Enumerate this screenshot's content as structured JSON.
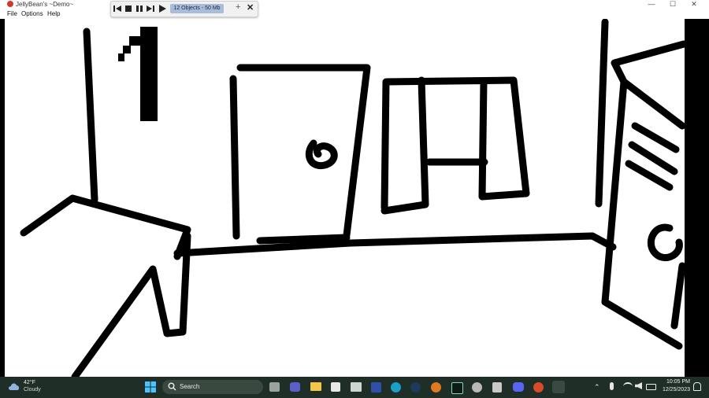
{
  "window": {
    "title": "JellyBean's ~Demo~",
    "minimize_glyph": "—",
    "maximize_glyph": "☐",
    "close_glyph": "✕"
  },
  "menu": {
    "items": [
      {
        "label": "File"
      },
      {
        "label": "Options"
      },
      {
        "label": "Help"
      }
    ]
  },
  "toolbar": {
    "status": "12 Objects - 50 Mb",
    "add_glyph": "+",
    "close_glyph": "✕",
    "buttons": [
      "skip-back",
      "stop",
      "pause",
      "skip-forward",
      "play"
    ]
  },
  "taskbar": {
    "weather_temp": "42°F",
    "weather_condition": "Cloudy",
    "search_placeholder": "Search",
    "time": "10:05 PM",
    "date": "12/25/2023",
    "accent": "#1f2e26"
  },
  "drawing": {
    "number_mark": "1",
    "background": "#ffffff",
    "ink": "#000000"
  }
}
